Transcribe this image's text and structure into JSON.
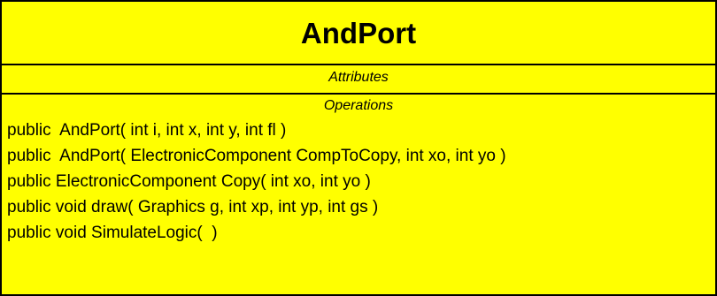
{
  "class": {
    "name": "AndPort",
    "attributes_header": "Attributes",
    "operations_header": "Operations",
    "operations": [
      "public  AndPort( int i, int x, int y, int fl )",
      "public  AndPort( ElectronicComponent CompToCopy, int xo, int yo )",
      "public ElectronicComponent Copy( int xo, int yo )",
      "public void draw( Graphics g, int xp, int yp, int gs )",
      "public void SimulateLogic(  )"
    ]
  },
  "colors": {
    "fill": "#ffff00",
    "border": "#000000",
    "text": "#000000"
  }
}
